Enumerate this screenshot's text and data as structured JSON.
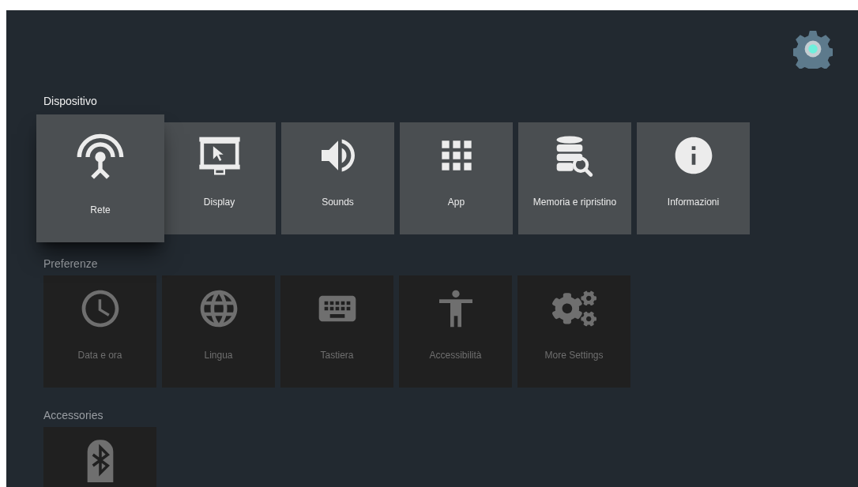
{
  "sections": [
    {
      "title": "Dispositivo",
      "active": true,
      "items": [
        {
          "label": "Rete",
          "focused": true
        },
        {
          "label": "Display",
          "focused": false
        },
        {
          "label": "Sounds",
          "focused": false
        },
        {
          "label": "App",
          "focused": false
        },
        {
          "label": "Memoria e ripristino",
          "focused": false
        },
        {
          "label": "Informazioni",
          "focused": false
        }
      ]
    },
    {
      "title": "Preferenze",
      "active": false,
      "items": [
        {
          "label": "Data e ora",
          "focused": false
        },
        {
          "label": "Lingua",
          "focused": false
        },
        {
          "label": "Tastiera",
          "focused": false
        },
        {
          "label": "Accessibilità",
          "focused": false
        },
        {
          "label": "More Settings",
          "focused": false
        }
      ]
    },
    {
      "title": "Accessories",
      "active": false,
      "items": [
        {
          "focused": false
        }
      ]
    }
  ]
}
